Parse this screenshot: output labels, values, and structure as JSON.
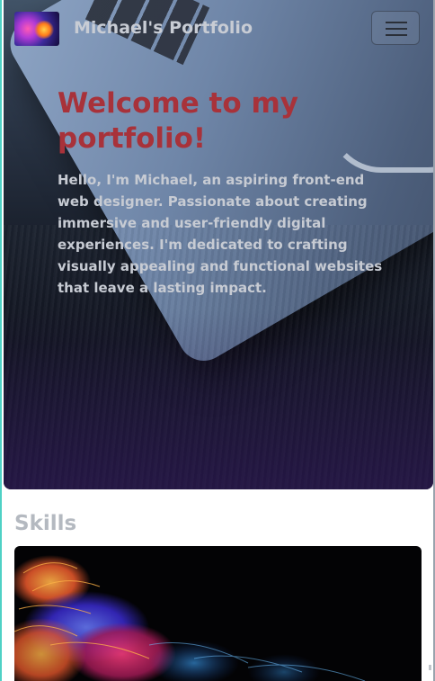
{
  "navbar": {
    "brand": "Michael's Portfolio",
    "logo_icon": "abstract-logo-icon",
    "menu_icon": "hamburger-menu-icon"
  },
  "hero": {
    "title": "Welcome to my portfolio!",
    "intro": "Hello, I'm Michael, an aspiring front-end web designer. Passionate about creating immersive and user-friendly digital experiences. I'm dedicated to crafting visually appealing and functional websites that leave a lasting impact."
  },
  "skills": {
    "heading": "Skills"
  },
  "colors": {
    "title_red": "#a8323a",
    "text_light": "#c7cbd3",
    "heading_gray": "#b4b9c0"
  }
}
